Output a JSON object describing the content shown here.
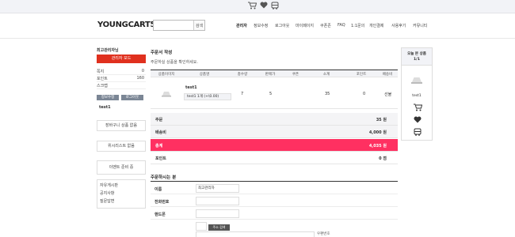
{
  "topbar": {
    "cart_icon": "cart-icon",
    "wish_icon": "heart-icon",
    "recent_icon": "bus-icon"
  },
  "header": {
    "logo": "YOUNGCART5",
    "search_placeholder": "",
    "search_btn": "검색",
    "menu": [
      "관리자",
      "정보수정",
      "로그아웃",
      "마이페이지",
      "쿠폰존",
      "FAQ",
      "1:1문의",
      "개인결제",
      "사용후기",
      "커뮤니티"
    ]
  },
  "sidebar": {
    "title": "최고관리자님",
    "admin_btn": "관리자 모드",
    "stats": [
      {
        "label": "쪽지",
        "value": "0"
      },
      {
        "label": "포인트",
        "value": "160"
      },
      {
        "label": "스크랩",
        "value": ""
      }
    ],
    "edit_btn": "정보수정",
    "logout_btn": "로그아웃",
    "username": "test1",
    "cart_box": "장바구니 상품 없음",
    "wish_box": "위시리스트 없음",
    "event_box": "이벤트 준비 중",
    "links": [
      "자유게시판",
      "공지사항",
      "질문답변"
    ]
  },
  "main": {
    "title": "주문서 작성",
    "notice": "주문하실 상품을 확인하세요.",
    "table": {
      "headers": [
        "상품이미지",
        "상품명",
        "총수량",
        "판매가",
        "쿠폰",
        "소계",
        "포인트",
        "배송비"
      ],
      "row": {
        "name": "test1",
        "option": "test1 1개 (+\\0.00)",
        "qty": "7",
        "price": "5",
        "coupon": "",
        "subtotal": "35",
        "point": "0",
        "shipping": "선불"
      }
    },
    "summary": {
      "order_label": "주문",
      "order_value": "35 원",
      "ship_label": "배송비",
      "ship_value": "4,000 원",
      "total_label": "총계",
      "total_value": "4,035 원",
      "point_label": "포인트",
      "point_value": "0 점"
    },
    "orderer": {
      "title": "주문하시는 분",
      "name_label": "이름",
      "name_value": "최고관리자",
      "phone_label": "전화번호",
      "phone_value": "",
      "mobile_label": "핸드폰",
      "mobile_value": "",
      "addr_btn": "주소 검색",
      "addr_note": "우편번호"
    }
  },
  "right_panel": {
    "title_line1": "오늘 본 상품",
    "title_line2": "1/1",
    "item": "test1"
  },
  "colors": {
    "accent": "#ff3061",
    "admin_red": "#e0301e"
  }
}
